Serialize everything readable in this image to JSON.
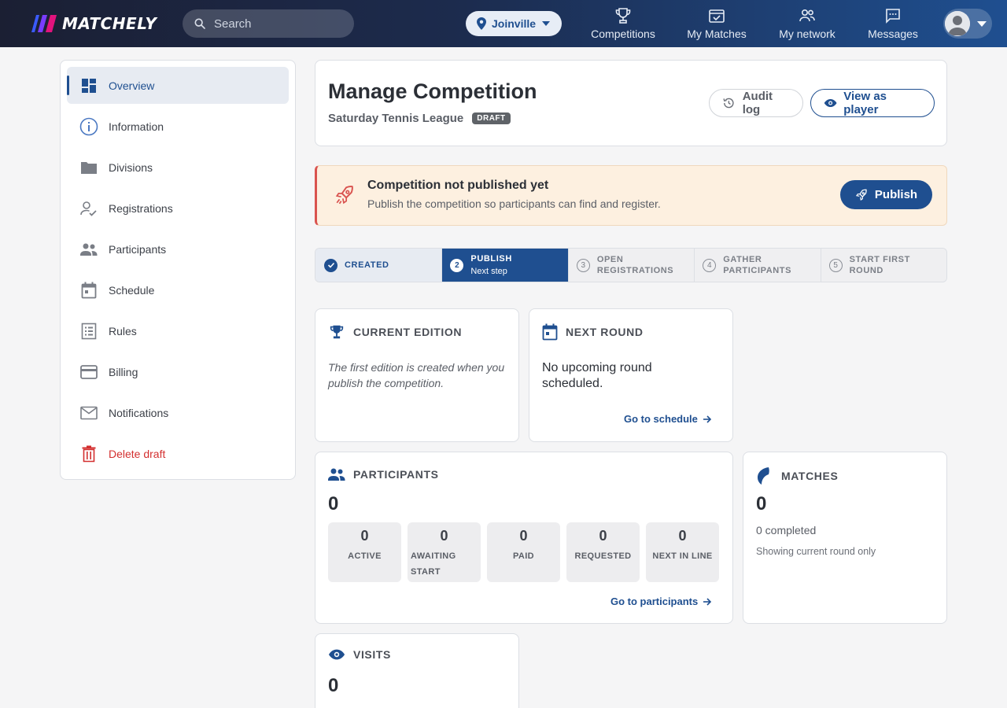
{
  "app": {
    "name": "MATCHELY"
  },
  "search": {
    "placeholder": "Search"
  },
  "location": {
    "label": "Joinville"
  },
  "nav": {
    "competitions": "Competitions",
    "my_matches": "My Matches",
    "my_network": "My network",
    "messages": "Messages"
  },
  "sidebar": {
    "items": [
      {
        "label": "Overview",
        "icon": "dashboard-icon",
        "active": true
      },
      {
        "label": "Information",
        "icon": "info-icon"
      },
      {
        "label": "Divisions",
        "icon": "folder-icon"
      },
      {
        "label": "Registrations",
        "icon": "registration-icon"
      },
      {
        "label": "Participants",
        "icon": "people-icon"
      },
      {
        "label": "Schedule",
        "icon": "calendar-icon"
      },
      {
        "label": "Rules",
        "icon": "rules-list-icon"
      },
      {
        "label": "Billing",
        "icon": "credit-card-icon"
      },
      {
        "label": "Notifications",
        "icon": "envelope-icon"
      },
      {
        "label": "Delete draft",
        "icon": "trash-icon",
        "danger": true
      }
    ]
  },
  "header": {
    "title": "Manage Competition",
    "competition_name": "Saturday Tennis League",
    "status_badge": "DRAFT",
    "audit_log": "Audit log",
    "view_as_player": "View as player"
  },
  "alert": {
    "title": "Competition not published yet",
    "text": "Publish the competition so participants can find and register.",
    "button": "Publish"
  },
  "steps": [
    {
      "n": "1",
      "label": "CREATED",
      "state": "done"
    },
    {
      "n": "2",
      "label": "PUBLISH",
      "sub": "Next step",
      "state": "current"
    },
    {
      "n": "3",
      "label": "OPEN",
      "label2": "REGISTRATIONS",
      "state": "todo"
    },
    {
      "n": "4",
      "label": "GATHER",
      "label2": "PARTICIPANTS",
      "state": "todo"
    },
    {
      "n": "5",
      "label": "START FIRST",
      "label2": "ROUND",
      "state": "todo"
    }
  ],
  "cards": {
    "current_edition": {
      "title": "CURRENT EDITION",
      "text": "The first edition is created when you publish the competition."
    },
    "next_round": {
      "title": "NEXT ROUND",
      "text": "No upcoming round scheduled.",
      "link": "Go to schedule"
    },
    "participants": {
      "title": "PARTICIPANTS",
      "total": "0",
      "stats": [
        {
          "value": "0",
          "label": "ACTIVE"
        },
        {
          "value": "0",
          "label": "AWAITING START"
        },
        {
          "value": "0",
          "label": "PAID"
        },
        {
          "value": "0",
          "label": "REQUESTED"
        },
        {
          "value": "0",
          "label": "NEXT IN LINE"
        }
      ],
      "link": "Go to participants"
    },
    "matches": {
      "title": "MATCHES",
      "total": "0",
      "completed": "0 completed",
      "note": "Showing current round only"
    },
    "visits": {
      "title": "VISITS",
      "total": "0"
    }
  },
  "colors": {
    "accent": "#1f4f90",
    "danger": "#d32f2f",
    "alert_bg": "#fdf0e0",
    "logo_blue": "#3b5bfd",
    "logo_pink": "#e2137d"
  }
}
